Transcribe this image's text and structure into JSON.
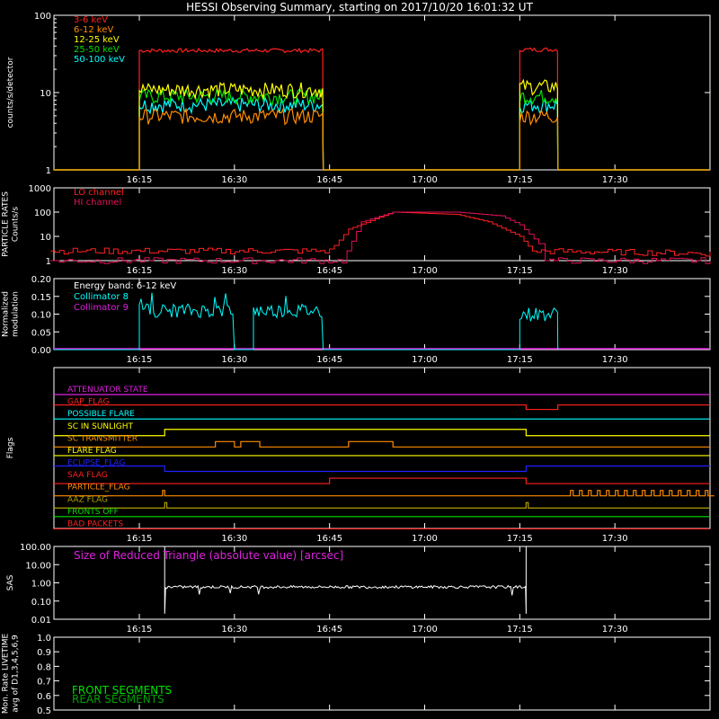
{
  "title": "HESSI Observing Summary, starting on 2017/10/20 16:01:32 UT",
  "time_ticks": [
    "16:15",
    "16:30",
    "16:45",
    "17:00",
    "17:15",
    "17:30"
  ],
  "colors": {
    "white": "#ffffff",
    "red": "#ff2020",
    "orange": "#ff8c00",
    "yellow": "#ffff00",
    "green": "#00e000",
    "cyan": "#00ffff",
    "magenta": "#e020e0",
    "blue": "#2020ff",
    "olive": "#b0a000",
    "darkgreen": "#00a000",
    "crimson": "#e0105a"
  },
  "chart_data": [
    {
      "id": "counts",
      "type": "line",
      "ylabel": "counts/s/detector",
      "yscale": "log",
      "ylim": [
        1,
        100
      ],
      "yticks": [
        "1",
        "10",
        "100"
      ],
      "x_range_minutes": [
        "16:01:32",
        "17:45"
      ],
      "legend": [
        {
          "name": "3-6 keV",
          "color": "#ff2020"
        },
        {
          "name": "6-12 keV",
          "color": "#ff8c00"
        },
        {
          "name": "12-25 keV",
          "color": "#ffff00"
        },
        {
          "name": "25-50 keV",
          "color": "#00e000"
        },
        {
          "name": "50-100 keV",
          "color": "#00ffff"
        }
      ],
      "series": [
        {
          "name": "3-6 keV",
          "segments": [
            {
              "start": "16:15",
              "end": "16:44",
              "value": 35
            },
            {
              "start": "17:15",
              "end": "17:21",
              "value": 36
            }
          ]
        },
        {
          "name": "6-12 keV",
          "segments": [
            {
              "start": "16:15",
              "end": "16:44",
              "value": 5
            },
            {
              "start": "17:15",
              "end": "17:21",
              "value": 5
            }
          ]
        },
        {
          "name": "12-25 keV",
          "segments": [
            {
              "start": "16:15",
              "end": "16:44",
              "value": 11
            },
            {
              "start": "17:15",
              "end": "17:21",
              "value": 12
            }
          ]
        },
        {
          "name": "25-50 keV",
          "segments": [
            {
              "start": "16:15",
              "end": "16:44",
              "value": 9
            },
            {
              "start": "17:15",
              "end": "17:21",
              "value": 9
            }
          ]
        },
        {
          "name": "50-100 keV",
          "segments": [
            {
              "start": "16:15",
              "end": "16:44",
              "value": 7
            },
            {
              "start": "17:15",
              "end": "17:21",
              "value": 7
            }
          ]
        }
      ]
    },
    {
      "id": "particles",
      "type": "line",
      "ylabel": "PARTICLE RATES Counts/s",
      "yscale": "log",
      "ylim": [
        1,
        1000
      ],
      "yticks": [
        "1",
        "10",
        "100",
        "1000"
      ],
      "legend": [
        {
          "name": "LO channel",
          "color": "#ff2020"
        },
        {
          "name": "HI channel",
          "color": "#e0105a"
        }
      ],
      "series": [
        {
          "name": "LO channel",
          "points": [
            [
              "16:01",
              2.5
            ],
            [
              "16:45",
              2.5
            ],
            [
              "16:48",
              20
            ],
            [
              "16:55",
              100
            ],
            [
              "17:05",
              80
            ],
            [
              "17:10",
              40
            ],
            [
              "17:15",
              10
            ],
            [
              "17:17",
              2.5
            ],
            [
              "17:45",
              2
            ]
          ]
        },
        {
          "name": "HI channel",
          "points": [
            [
              "16:01",
              1
            ],
            [
              "16:47",
              1
            ],
            [
              "16:50",
              40
            ],
            [
              "16:55",
              100
            ],
            [
              "17:05",
              100
            ],
            [
              "17:12",
              70
            ],
            [
              "17:15",
              30
            ],
            [
              "17:18",
              5
            ],
            [
              "17:19",
              1
            ],
            [
              "17:45",
              1
            ]
          ]
        }
      ]
    },
    {
      "id": "modulation",
      "type": "line",
      "ylabel": "Normalized modulation",
      "ylim": [
        0,
        0.2
      ],
      "yticks": [
        "0.00",
        "0.05",
        "0.10",
        "0.15",
        "0.20"
      ],
      "legend_title": "Energy band: 6-12 keV",
      "legend": [
        {
          "name": "Collimator 8",
          "color": "#00ffff"
        },
        {
          "name": "Collimator 9",
          "color": "#e020e0"
        }
      ],
      "series": [
        {
          "name": "Collimator 8",
          "segments": [
            {
              "start": "16:15",
              "end": "16:30",
              "value": 0.11
            },
            {
              "start": "16:33",
              "end": "16:44",
              "value": 0.11
            },
            {
              "start": "17:15",
              "end": "17:21",
              "value": 0.1
            }
          ]
        },
        {
          "name": "Collimator 9",
          "value": 0.0
        }
      ]
    },
    {
      "id": "flags",
      "type": "line",
      "ylabel": "Flags",
      "flags": [
        {
          "name": "ATTENUATOR STATE",
          "color": "#e020e0"
        },
        {
          "name": "GAP_FLAG",
          "color": "#ff2020"
        },
        {
          "name": "POSSIBLE FLARE",
          "color": "#00ffff"
        },
        {
          "name": "SC IN SUNLIGHT",
          "color": "#ffff00"
        },
        {
          "name": "SC TRANSMITTER",
          "color": "#ff8c00"
        },
        {
          "name": "FLARE FLAG",
          "color": "#ffff00"
        },
        {
          "name": "ECLIPSE_FLAG",
          "color": "#2020ff"
        },
        {
          "name": "SAA FLAG",
          "color": "#ff2020"
        },
        {
          "name": "PARTICLE_FLAG",
          "color": "#ff8c00"
        },
        {
          "name": "AAZ FLAG",
          "color": "#b0a000"
        },
        {
          "name": "FRONTS OFF",
          "color": "#00e000"
        },
        {
          "name": "BAD PACKETS",
          "color": "#ff2020"
        }
      ]
    },
    {
      "id": "sas",
      "type": "line",
      "ylabel": "SAS",
      "yscale": "log",
      "yticks": [
        "0.01",
        "0.10",
        "1.00",
        "10.00",
        "100.00"
      ],
      "ylim": [
        0.01,
        100
      ],
      "annotation": "Size of Reduced Triangle (absolute value) [arcsec]",
      "series": [
        {
          "name": "Size of Reduced Triangle",
          "segment": {
            "start": "16:19",
            "end": "17:16",
            "value": 0.6
          }
        }
      ]
    },
    {
      "id": "livetime",
      "type": "line",
      "ylabel": "Mon. Rate LIVETIME avg of D1,3,4,5,6,9",
      "ylim": [
        0.5,
        1.0
      ],
      "yticks": [
        "0.5",
        "0.6",
        "0.7",
        "0.8",
        "0.9",
        "1.0"
      ],
      "legend": [
        {
          "name": "FRONT SEGMENTS",
          "color": "#00e000"
        },
        {
          "name": "REAR SEGMENTS",
          "color": "#00a000"
        }
      ]
    }
  ]
}
